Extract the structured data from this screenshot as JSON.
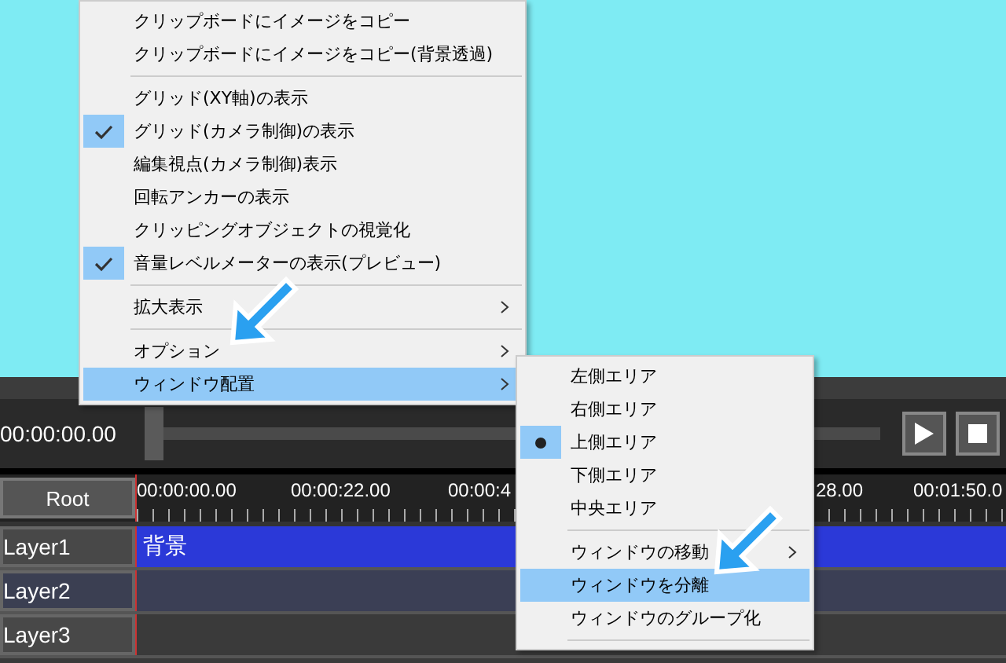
{
  "menu": {
    "items": [
      {
        "kind": "item",
        "label": "クリップボードにイメージをコピー",
        "checked": false,
        "highlighted": false,
        "has_submenu": false
      },
      {
        "kind": "item",
        "label": "クリップボードにイメージをコピー(背景透過)",
        "checked": false,
        "highlighted": false,
        "has_submenu": false
      },
      {
        "kind": "separator"
      },
      {
        "kind": "item",
        "label": "グリッド(XY軸)の表示",
        "checked": false,
        "highlighted": false,
        "has_submenu": false
      },
      {
        "kind": "item",
        "label": "グリッド(カメラ制御)の表示",
        "checked": true,
        "highlighted": false,
        "has_submenu": false
      },
      {
        "kind": "item",
        "label": "編集視点(カメラ制御)表示",
        "checked": false,
        "highlighted": false,
        "has_submenu": false
      },
      {
        "kind": "item",
        "label": "回転アンカーの表示",
        "checked": false,
        "highlighted": false,
        "has_submenu": false
      },
      {
        "kind": "item",
        "label": "クリッピングオブジェクトの視覚化",
        "checked": false,
        "highlighted": false,
        "has_submenu": false
      },
      {
        "kind": "item",
        "label": "音量レベルメーターの表示(プレビュー)",
        "checked": true,
        "highlighted": false,
        "has_submenu": false
      },
      {
        "kind": "separator"
      },
      {
        "kind": "item",
        "label": "拡大表示",
        "checked": false,
        "highlighted": false,
        "has_submenu": true
      },
      {
        "kind": "separator"
      },
      {
        "kind": "item",
        "label": "オプション",
        "checked": false,
        "highlighted": false,
        "has_submenu": true
      },
      {
        "kind": "item",
        "label": "ウィンドウ配置",
        "checked": false,
        "highlighted": true,
        "has_submenu": true
      }
    ]
  },
  "submenu": {
    "items": [
      {
        "kind": "item",
        "label": "左側エリア",
        "checked": false,
        "highlighted": false,
        "has_submenu": false
      },
      {
        "kind": "item",
        "label": "右側エリア",
        "checked": false,
        "highlighted": false,
        "has_submenu": false
      },
      {
        "kind": "item",
        "label": "上側エリア",
        "checked": true,
        "highlighted": false,
        "has_submenu": false
      },
      {
        "kind": "item",
        "label": "下側エリア",
        "checked": false,
        "highlighted": false,
        "has_submenu": false
      },
      {
        "kind": "item",
        "label": "中央エリア",
        "checked": false,
        "highlighted": false,
        "has_submenu": false
      },
      {
        "kind": "separator"
      },
      {
        "kind": "item",
        "label": "ウィンドウの移動",
        "checked": false,
        "highlighted": false,
        "has_submenu": true
      },
      {
        "kind": "item",
        "label": "ウィンドウを分離",
        "checked": false,
        "highlighted": true,
        "has_submenu": false
      },
      {
        "kind": "item",
        "label": "ウィンドウのグループ化",
        "checked": false,
        "highlighted": false,
        "has_submenu": false
      },
      {
        "kind": "separator"
      }
    ]
  },
  "toolbar": {
    "time": "00:00:00.00",
    "level": 0
  },
  "timeline": {
    "root_button": "Root",
    "ruler_labels": [
      "00:00:00.00",
      "00:00:22.00",
      "00:00:4",
      "28.00",
      "00:01:50.0"
    ],
    "layers": [
      {
        "name": "Layer1",
        "selected": false,
        "clip": "背景"
      },
      {
        "name": "Layer2",
        "selected": true
      },
      {
        "name": "Layer3",
        "selected": false
      }
    ]
  }
}
